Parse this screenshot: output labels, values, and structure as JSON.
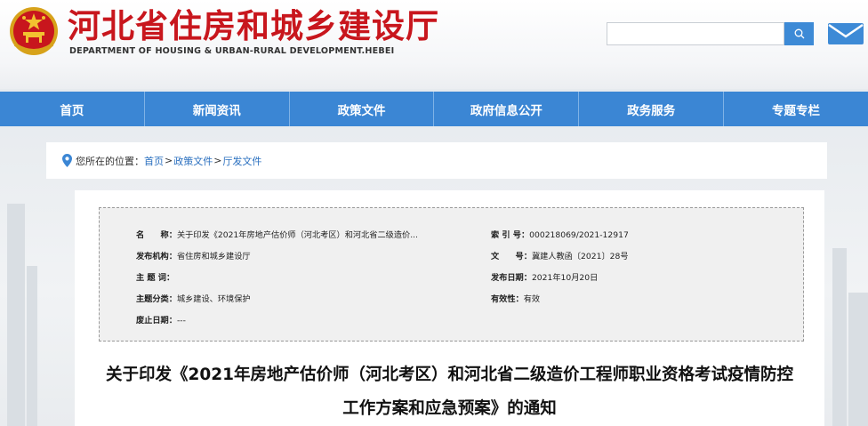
{
  "header": {
    "title": "河北省住房和城乡建设厅",
    "subtitle": "DEPARTMENT OF HOUSING & URBAN-RURAL DEVELOPMENT.HEBEI",
    "search_placeholder": "",
    "brand_color": "#c8161d",
    "accent_color": "#3b86d4"
  },
  "nav": {
    "items": [
      "首页",
      "新闻资讯",
      "政策文件",
      "政府信息公开",
      "政务服务",
      "专题专栏"
    ]
  },
  "breadcrumb": {
    "prefix": "您所在的位置：",
    "items": [
      "首页",
      "政策文件",
      "厅发文件"
    ],
    "separator": ">"
  },
  "meta": {
    "name_key": "名　　称：",
    "name_value": "关于印发《2021年房地产估价师（河北考区）和河北省二级造价...",
    "index_key": "索 引 号：",
    "index_value": "000218069/2021-12917",
    "issuer_key": "发布机构：",
    "issuer_value": "省住房和城乡建设厅",
    "docno_key": "文　　号：",
    "docno_value": "冀建人教函〔2021〕28号",
    "subject_key": "主 题 词：",
    "subject_value": "",
    "date_key": "发布日期：",
    "date_value": "2021年10月20日",
    "category_key": "主题分类：",
    "category_value": "城乡建设、环境保护",
    "validity_key": "有效性：",
    "validity_value": "有效",
    "expire_key": "废止日期：",
    "expire_value": "---"
  },
  "article": {
    "title_line1": "关于印发《2021年房地产估价师（河北考区）和河北省二级造价工程师职业资格考试疫情防控",
    "title_line2": "工作方案和应急预案》的通知"
  },
  "icons": {
    "search": "search-icon",
    "mail": "mail-icon",
    "location": "location-pin-icon",
    "emblem": "national-emblem-icon"
  }
}
